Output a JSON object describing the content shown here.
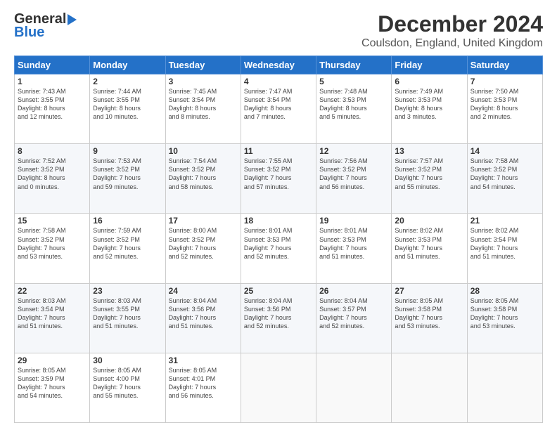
{
  "logo": {
    "line1": "General",
    "line2": "Blue"
  },
  "title": "December 2024",
  "subtitle": "Coulsdon, England, United Kingdom",
  "days_header": [
    "Sunday",
    "Monday",
    "Tuesday",
    "Wednesday",
    "Thursday",
    "Friday",
    "Saturday"
  ],
  "weeks": [
    [
      {
        "day": "1",
        "info": "Sunrise: 7:43 AM\nSunset: 3:55 PM\nDaylight: 8 hours\nand 12 minutes."
      },
      {
        "day": "2",
        "info": "Sunrise: 7:44 AM\nSunset: 3:55 PM\nDaylight: 8 hours\nand 10 minutes."
      },
      {
        "day": "3",
        "info": "Sunrise: 7:45 AM\nSunset: 3:54 PM\nDaylight: 8 hours\nand 8 minutes."
      },
      {
        "day": "4",
        "info": "Sunrise: 7:47 AM\nSunset: 3:54 PM\nDaylight: 8 hours\nand 7 minutes."
      },
      {
        "day": "5",
        "info": "Sunrise: 7:48 AM\nSunset: 3:53 PM\nDaylight: 8 hours\nand 5 minutes."
      },
      {
        "day": "6",
        "info": "Sunrise: 7:49 AM\nSunset: 3:53 PM\nDaylight: 8 hours\nand 3 minutes."
      },
      {
        "day": "7",
        "info": "Sunrise: 7:50 AM\nSunset: 3:53 PM\nDaylight: 8 hours\nand 2 minutes."
      }
    ],
    [
      {
        "day": "8",
        "info": "Sunrise: 7:52 AM\nSunset: 3:52 PM\nDaylight: 8 hours\nand 0 minutes."
      },
      {
        "day": "9",
        "info": "Sunrise: 7:53 AM\nSunset: 3:52 PM\nDaylight: 7 hours\nand 59 minutes."
      },
      {
        "day": "10",
        "info": "Sunrise: 7:54 AM\nSunset: 3:52 PM\nDaylight: 7 hours\nand 58 minutes."
      },
      {
        "day": "11",
        "info": "Sunrise: 7:55 AM\nSunset: 3:52 PM\nDaylight: 7 hours\nand 57 minutes."
      },
      {
        "day": "12",
        "info": "Sunrise: 7:56 AM\nSunset: 3:52 PM\nDaylight: 7 hours\nand 56 minutes."
      },
      {
        "day": "13",
        "info": "Sunrise: 7:57 AM\nSunset: 3:52 PM\nDaylight: 7 hours\nand 55 minutes."
      },
      {
        "day": "14",
        "info": "Sunrise: 7:58 AM\nSunset: 3:52 PM\nDaylight: 7 hours\nand 54 minutes."
      }
    ],
    [
      {
        "day": "15",
        "info": "Sunrise: 7:58 AM\nSunset: 3:52 PM\nDaylight: 7 hours\nand 53 minutes."
      },
      {
        "day": "16",
        "info": "Sunrise: 7:59 AM\nSunset: 3:52 PM\nDaylight: 7 hours\nand 52 minutes."
      },
      {
        "day": "17",
        "info": "Sunrise: 8:00 AM\nSunset: 3:52 PM\nDaylight: 7 hours\nand 52 minutes."
      },
      {
        "day": "18",
        "info": "Sunrise: 8:01 AM\nSunset: 3:53 PM\nDaylight: 7 hours\nand 52 minutes."
      },
      {
        "day": "19",
        "info": "Sunrise: 8:01 AM\nSunset: 3:53 PM\nDaylight: 7 hours\nand 51 minutes."
      },
      {
        "day": "20",
        "info": "Sunrise: 8:02 AM\nSunset: 3:53 PM\nDaylight: 7 hours\nand 51 minutes."
      },
      {
        "day": "21",
        "info": "Sunrise: 8:02 AM\nSunset: 3:54 PM\nDaylight: 7 hours\nand 51 minutes."
      }
    ],
    [
      {
        "day": "22",
        "info": "Sunrise: 8:03 AM\nSunset: 3:54 PM\nDaylight: 7 hours\nand 51 minutes."
      },
      {
        "day": "23",
        "info": "Sunrise: 8:03 AM\nSunset: 3:55 PM\nDaylight: 7 hours\nand 51 minutes."
      },
      {
        "day": "24",
        "info": "Sunrise: 8:04 AM\nSunset: 3:56 PM\nDaylight: 7 hours\nand 51 minutes."
      },
      {
        "day": "25",
        "info": "Sunrise: 8:04 AM\nSunset: 3:56 PM\nDaylight: 7 hours\nand 52 minutes."
      },
      {
        "day": "26",
        "info": "Sunrise: 8:04 AM\nSunset: 3:57 PM\nDaylight: 7 hours\nand 52 minutes."
      },
      {
        "day": "27",
        "info": "Sunrise: 8:05 AM\nSunset: 3:58 PM\nDaylight: 7 hours\nand 53 minutes."
      },
      {
        "day": "28",
        "info": "Sunrise: 8:05 AM\nSunset: 3:58 PM\nDaylight: 7 hours\nand 53 minutes."
      }
    ],
    [
      {
        "day": "29",
        "info": "Sunrise: 8:05 AM\nSunset: 3:59 PM\nDaylight: 7 hours\nand 54 minutes."
      },
      {
        "day": "30",
        "info": "Sunrise: 8:05 AM\nSunset: 4:00 PM\nDaylight: 7 hours\nand 55 minutes."
      },
      {
        "day": "31",
        "info": "Sunrise: 8:05 AM\nSunset: 4:01 PM\nDaylight: 7 hours\nand 56 minutes."
      },
      null,
      null,
      null,
      null
    ]
  ]
}
